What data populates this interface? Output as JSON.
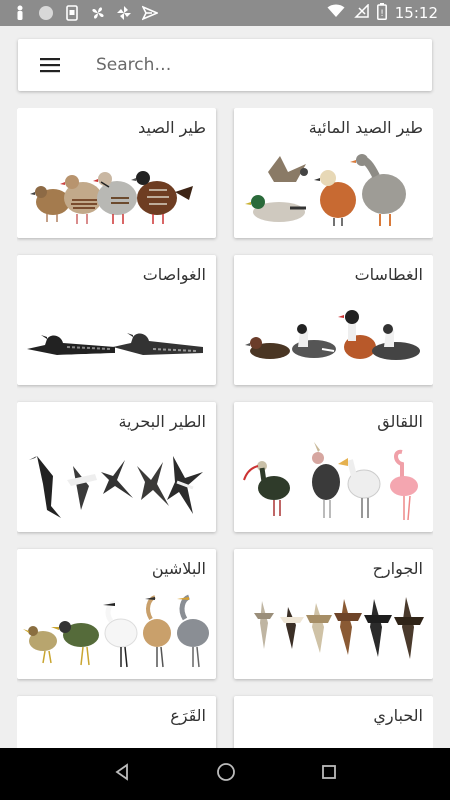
{
  "status_bar": {
    "time": "15:12",
    "left_icons": [
      "person-icon",
      "circle-icon",
      "sim-icon",
      "fan-icon",
      "pinwheel-icon",
      "send-icon"
    ],
    "right_icons": [
      "wifi-icon",
      "no-sim-icon",
      "battery-icon"
    ]
  },
  "search": {
    "placeholder": "Search…"
  },
  "categories": [
    {
      "label": "طير الصيد"
    },
    {
      "label": "طير الصيد المائية"
    },
    {
      "label": "الغواصات"
    },
    {
      "label": "الغطاسات"
    },
    {
      "label": "الطير البحرية"
    },
    {
      "label": "اللقالق"
    },
    {
      "label": "البلاشين"
    },
    {
      "label": "الجوارح"
    },
    {
      "label": "القَرَع"
    },
    {
      "label": "الحباري"
    }
  ]
}
